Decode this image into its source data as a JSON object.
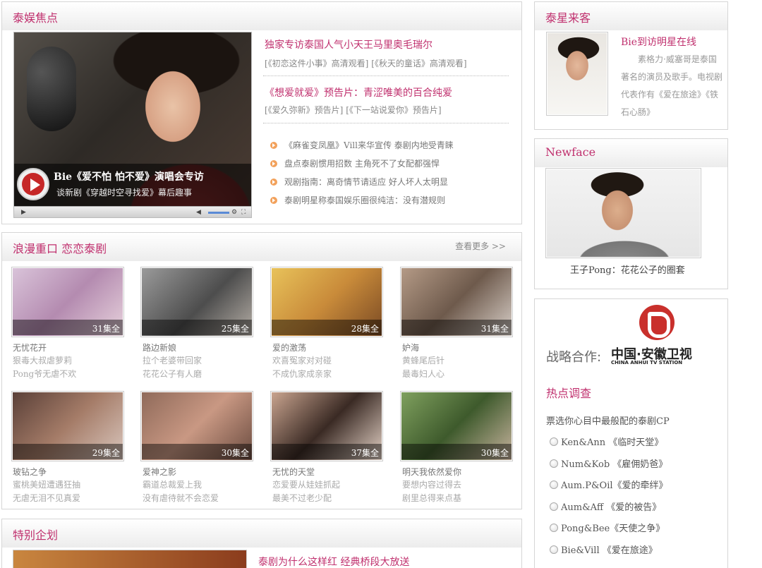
{
  "focus": {
    "title": "泰娱焦点",
    "video": {
      "title": "Bie《爱不怕 怕不爱》演唱会专访",
      "subtitle": "谈新剧《穿越时空寻找爱》幕后趣事"
    },
    "headline1": "独家专访泰国人气小天王马里奥毛瑞尔",
    "sub1": [
      "[《初恋这件小事》高清观看]",
      "[《秋天的童话》高清观看]"
    ],
    "headline2": "《想爱就爱》预告片：青涩唯美的百合纯爱",
    "sub2": [
      "[《爱久弥新》预告片]",
      "[《下一站说爱你》预告片]"
    ],
    "news": [
      "《麻雀变凤凰》Vill来华宣传 泰剧内地受青睐",
      "盘点泰剧惯用招数 主角死不了女配都强悍",
      "观剧指南：离奇情节请适应 好人坏人太明显",
      "泰剧明星称泰国娱乐圈很纯洁：没有潜规则"
    ]
  },
  "romance": {
    "title": "浪漫重口 恋恋泰剧",
    "more": "查看更多 >>",
    "dramas": [
      {
        "title": "无忧花开",
        "line1": "狠毒大叔虐萝莉",
        "line2": "Pong爷无虐不欢",
        "episodes": "31集全"
      },
      {
        "title": "路边新娘",
        "line1": "拉个老婆带回家",
        "line2": "花花公子有人磨",
        "episodes": "25集全"
      },
      {
        "title": "爱的激荡",
        "line1": "欢喜冤家对对碰",
        "line2": "不成仇家成亲家",
        "episodes": "28集全"
      },
      {
        "title": "妒海",
        "line1": "黄蜂尾后针",
        "line2": "最毒妇人心",
        "episodes": "31集全"
      },
      {
        "title": "玻钻之争",
        "line1": "蜜桃美妞遭遇狂抽",
        "line2": "无虐无泪不见真爱",
        "episodes": "29集全"
      },
      {
        "title": "爱神之影",
        "line1": "霸道总裁爱上我",
        "line2": "没有虐待就不会恋爱",
        "episodes": "30集全"
      },
      {
        "title": "无忧的天堂",
        "line1": "恋爱要从娃娃抓起",
        "line2": "最美不过老少配",
        "episodes": "37集全"
      },
      {
        "title": "明天我依然爱你",
        "line1": "要想内容过得去",
        "line2": "剧里总得来点基",
        "episodes": "30集全"
      }
    ]
  },
  "special": {
    "title": "特别企划",
    "headline": "泰剧为什么这样红 经典桥段大放送"
  },
  "guest": {
    "title": "泰星来客",
    "name": "Bie到访明星在线",
    "desc": "素格力·威塞哥是泰国著名的演员及歌手。电视剧代表作有《爱在旅途》《铁石心肠》"
  },
  "newface": {
    "title": "Newface",
    "caption": "王子Pong：花花公子的圈套"
  },
  "partner": {
    "label": "战略合作:",
    "logo_cn": "中国·安徽卫视",
    "logo_en": "CHINA ANHUI TV STATION"
  },
  "survey": {
    "title": "热点调查",
    "question": "票选你心目中最般配的泰剧CP",
    "options": [
      "Ken&Ann 《临时天堂》",
      "Num&Kob 《雇佣奶爸》",
      "Aum.P&Oil《爱的牵绊》",
      "Aum&Aff 《爱的被告》",
      "Pong&Bee《天使之争》",
      "Bie&Vill 《爱在旅途》"
    ]
  }
}
